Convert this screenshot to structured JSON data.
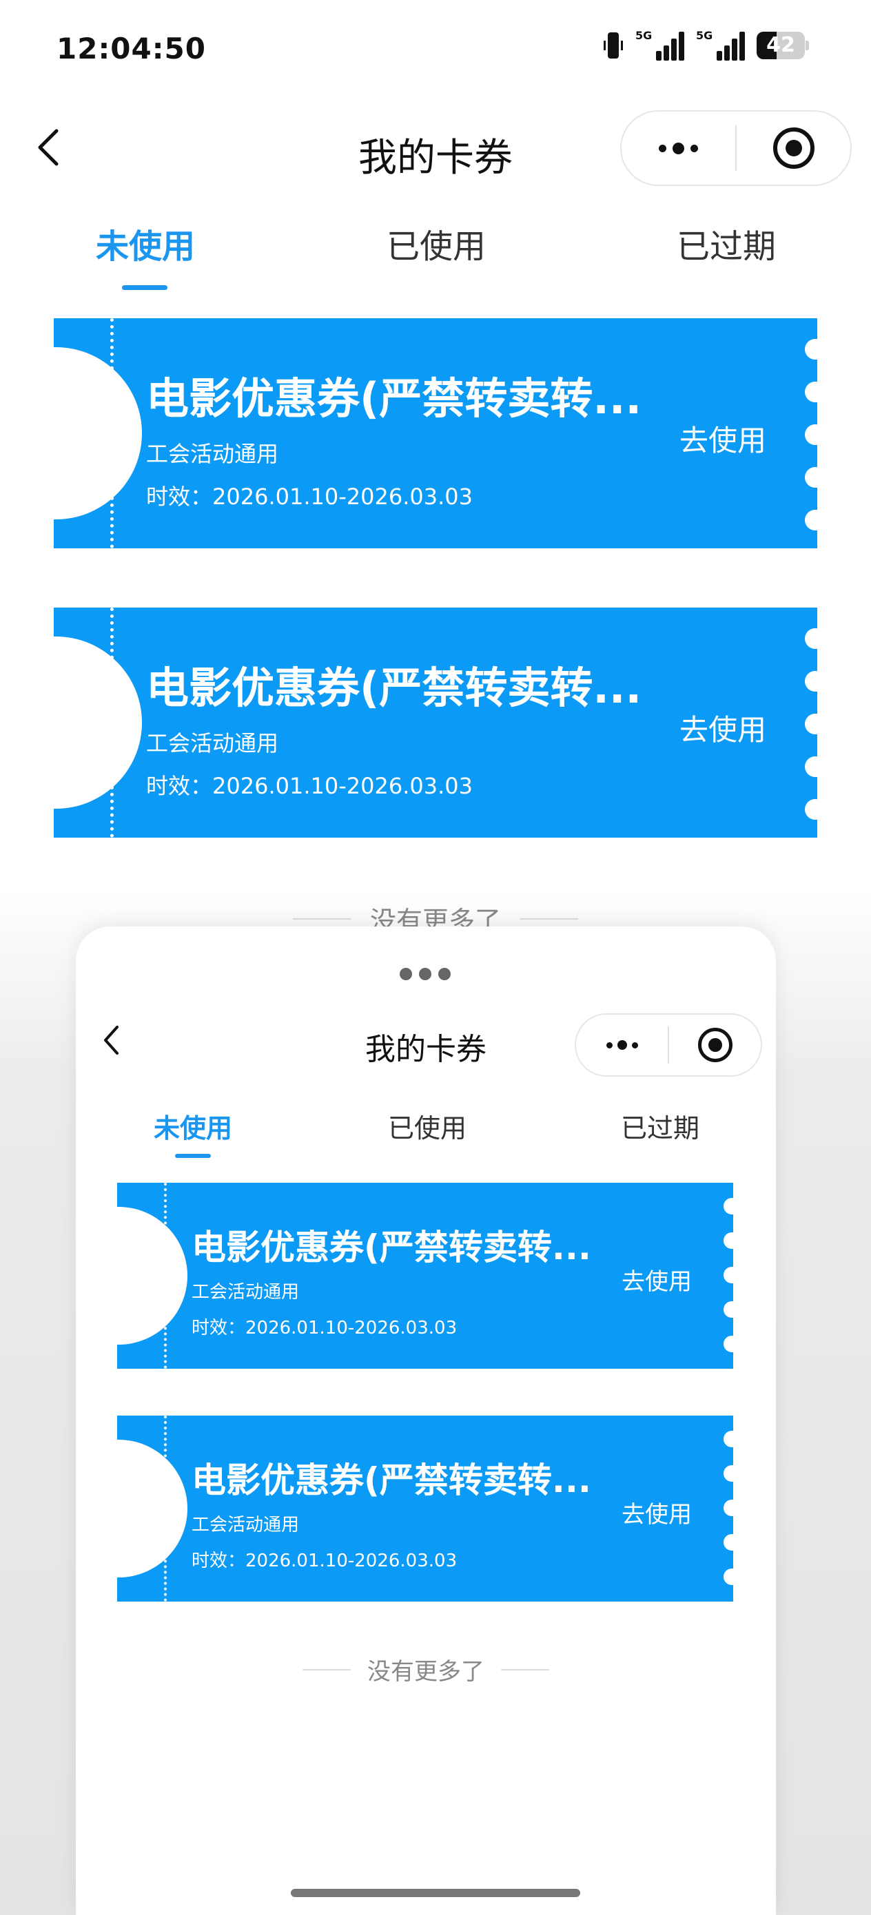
{
  "status_bar": {
    "time": "12:04:50",
    "signal1_label": "5G",
    "signal2_label": "5G",
    "battery_level": "42",
    "battery_fraction": 0.42
  },
  "page": {
    "title": "我的卡券",
    "tabs": [
      {
        "label": "未使用",
        "active": true
      },
      {
        "label": "已使用",
        "active": false
      },
      {
        "label": "已过期",
        "active": false
      }
    ],
    "coupons": [
      {
        "title": "电影优惠券(严禁转卖转...",
        "subtitle": "工会活动通用",
        "validity": "时效：2026.01.10-2026.03.03",
        "action": "去使用"
      },
      {
        "title": "电影优惠券(严禁转卖转...",
        "subtitle": "工会活动通用",
        "validity": "时效：2026.01.10-2026.03.03",
        "action": "去使用"
      }
    ],
    "end_text": "没有更多了"
  },
  "sheet": {
    "title": "我的卡券",
    "tabs": [
      {
        "label": "未使用",
        "active": true
      },
      {
        "label": "已使用",
        "active": false
      },
      {
        "label": "已过期",
        "active": false
      }
    ],
    "coupons": [
      {
        "title": "电影优惠券(严禁转卖转...",
        "subtitle": "工会活动通用",
        "validity": "时效：2026.01.10-2026.03.03",
        "action": "去使用"
      },
      {
        "title": "电影优惠券(严禁转卖转...",
        "subtitle": "工会活动通用",
        "validity": "时效：2026.01.10-2026.03.03",
        "action": "去使用"
      }
    ],
    "end_text": "没有更多了"
  },
  "icons": {
    "back": "chevron-left-icon",
    "more": "more-dots-icon",
    "close": "target-close-icon",
    "vibrate": "vibrate-icon",
    "signal": "signal-icon",
    "battery": "battery-icon"
  },
  "colors": {
    "accent": "#1a96f0",
    "coupon_bg": "#0b9af5",
    "background": "#ffffff"
  }
}
